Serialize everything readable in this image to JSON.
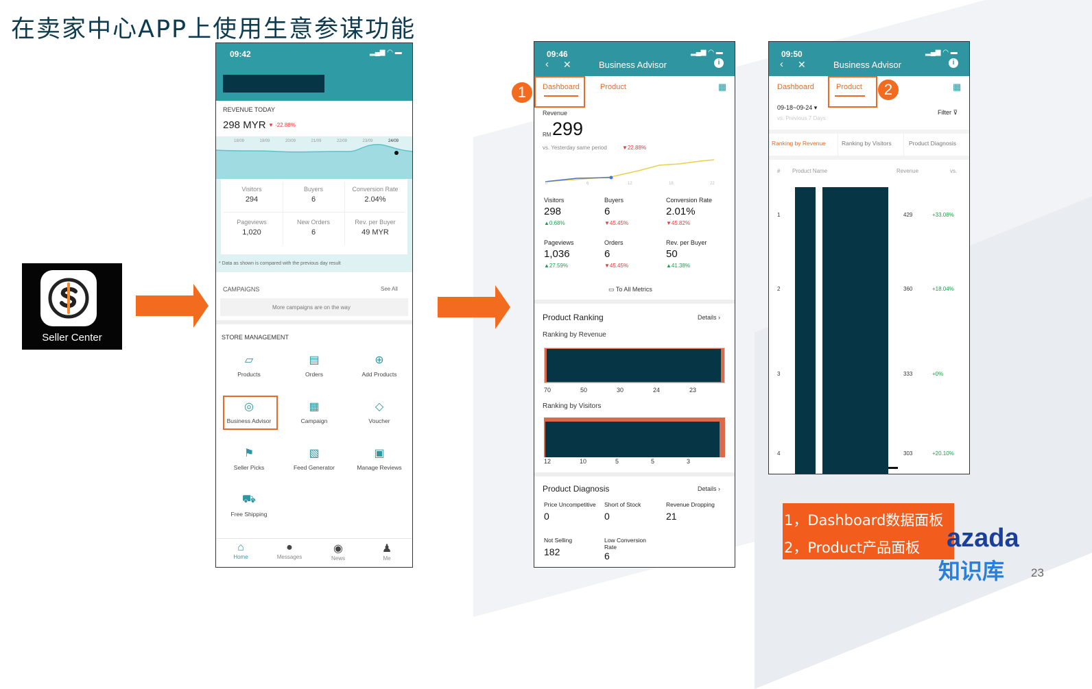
{
  "slide": {
    "title": "在卖家中心APP上使用生意参谋功能",
    "page_number": "23"
  },
  "logo": {
    "label": "Seller Center"
  },
  "callout": {
    "line1": "1，Dashboard数据面板",
    "line2": "2，Product产品面板"
  },
  "brand": {
    "lazada": "azada",
    "zhishiku": "知识库"
  },
  "phone1": {
    "time": "09:42",
    "revenue_label": "REVENUE TODAY",
    "revenue_value": "298 MYR",
    "revenue_change": "-22.88%",
    "dates": [
      "18/09",
      "19/09",
      "20/09",
      "21/09",
      "22/09",
      "23/09",
      "24/09"
    ],
    "metrics": [
      {
        "label": "Visitors",
        "value": "294"
      },
      {
        "label": "Buyers",
        "value": "6"
      },
      {
        "label": "Conversion Rate",
        "value": "2.04%"
      },
      {
        "label": "Pageviews",
        "value": "1,020"
      },
      {
        "label": "New Orders",
        "value": "6"
      },
      {
        "label": "Rev. per Buyer",
        "value": "49 MYR"
      }
    ],
    "note": "* Data as shown is compared with the previous day result",
    "campaigns_label": "CAMPAIGNS",
    "see_all": "See All",
    "campaigns_msg": "More campaigns are on the way",
    "store_label": "STORE MANAGEMENT",
    "store_items": [
      "Products",
      "Orders",
      "Add Products",
      "Business Advisor",
      "Campaign",
      "Voucher",
      "Seller Picks",
      "Feed Generator",
      "Manage Reviews",
      "Free Shipping"
    ],
    "nav": [
      "Home",
      "Messages",
      "News",
      "Me"
    ]
  },
  "phone2": {
    "time": "09:46",
    "title": "Business Advisor",
    "tab_dashboard": "Dashboard",
    "tab_product": "Product",
    "revenue_label": "Revenue",
    "currency": "RM",
    "revenue_value": "299",
    "compare_text": "vs. Yesterday same period",
    "compare_change": "▼22.88%",
    "axis": [
      "0",
      "6",
      "12",
      "18",
      "22"
    ],
    "metrics": [
      {
        "label": "Visitors",
        "value": "298",
        "change": "▲0.68%",
        "dir": "up"
      },
      {
        "label": "Buyers",
        "value": "6",
        "change": "▼45.45%",
        "dir": "dn"
      },
      {
        "label": "Conversion Rate",
        "value": "2.01%",
        "change": "▼45.82%",
        "dir": "dn"
      },
      {
        "label": "Pageviews",
        "value": "1,036",
        "change": "▲27.59%",
        "dir": "up"
      },
      {
        "label": "Orders",
        "value": "6",
        "change": "▼45.45%",
        "dir": "dn"
      },
      {
        "label": "Rev. per Buyer",
        "value": "50",
        "change": "▲41.38%",
        "dir": "up"
      }
    ],
    "all_metrics": "To All Metrics",
    "ranking_title": "Product Ranking",
    "details": "Details",
    "ranking_revenue": "Ranking by Revenue",
    "revenue_values": [
      "70",
      "50",
      "30",
      "24",
      "23"
    ],
    "ranking_visitors": "Ranking by Visitors",
    "visitor_values": [
      "12",
      "10",
      "5",
      "5",
      "3"
    ],
    "diagnosis_title": "Product Diagnosis",
    "diagnosis": [
      {
        "label": "Price Uncompetitive",
        "value": "0"
      },
      {
        "label": "Short of Stock",
        "value": "0"
      },
      {
        "label": "Revenue Dropping",
        "value": "21"
      },
      {
        "label": "Not Selling",
        "value": "182"
      },
      {
        "label": "Low Conversion Rate",
        "value": "6"
      }
    ]
  },
  "phone3": {
    "time": "09:50",
    "title": "Business Advisor",
    "tab_dashboard": "Dashboard",
    "tab_product": "Product",
    "date_range": "09-18~09-24",
    "vs_text": "vs. Previous 7 Days",
    "filter": "Filter",
    "subtabs": [
      "Ranking by Revenue",
      "Ranking by Visitors",
      "Product Diagnosis"
    ],
    "headers": {
      "num": "#",
      "name": "Product Name",
      "revenue": "Revenue",
      "vs": "vs."
    },
    "rows": [
      {
        "rank": "1",
        "revenue": "429",
        "change": "+33.08%"
      },
      {
        "rank": "2",
        "revenue": "360",
        "change": "+18.04%"
      },
      {
        "rank": "3",
        "revenue": "333",
        "change": "+0%"
      },
      {
        "rank": "4",
        "revenue": "303",
        "change": "+20.10%"
      }
    ]
  },
  "badges": {
    "one": "1",
    "two": "2"
  },
  "colors": {
    "teal": "#2f9ba5",
    "accent": "#f26b1f",
    "redact": "#063545",
    "title": "#0f3b4f"
  }
}
